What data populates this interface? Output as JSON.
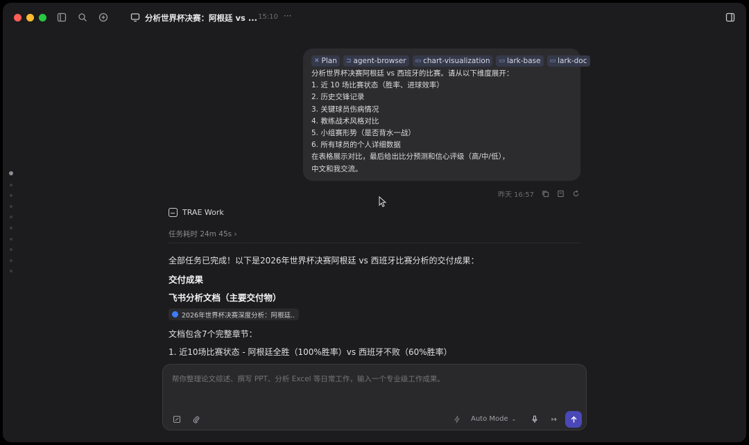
{
  "titlebar": {
    "title": "分析世界杯决赛：阿根廷 vs ...",
    "time": "15:10",
    "more": "···"
  },
  "user_message": {
    "chips": [
      {
        "icon": "plan-icon",
        "label": "Plan"
      },
      {
        "icon": "browser-icon",
        "label": "agent-browser"
      },
      {
        "icon": "book-icon",
        "label": "chart-visualization"
      },
      {
        "icon": "book-icon",
        "label": "lark-base"
      },
      {
        "icon": "book-icon",
        "label": "lark-doc"
      }
    ],
    "lines": [
      "分析世界杯决赛阿根廷 vs 西班牙的比赛。请从以下维度展开：",
      "1. 近 10 场比赛状态（胜率、进球效率）",
      "2. 历史交锋记录",
      "3. 关键球员伤病情况",
      "4. 教练战术风格对比",
      "5. 小组赛形势（是否背水一战）",
      "6. 所有球员的个人详细数据",
      "在表格展示对比，最后给出比分预测和信心评级（高/中/低），",
      "中文和我交流。"
    ],
    "timestamp": "昨天 16:57"
  },
  "assistant": {
    "name": "TRAE Work",
    "duration": "任务耗时 24m 45s ›",
    "intro": "全部任务已完成！以下是2026年世界杯决赛阿根廷 vs 西班牙比赛分析的交付成果：",
    "heading1": "交付成果",
    "heading2": "飞书分析文档（主要交付物）",
    "doc_title": "2026年世界杯决赛深度分析：阿根廷...",
    "doc_note": "文档包含7个完整章节：",
    "item1": "1. 近10场比赛状态 - 阿根廷全胜（100%胜率）vs 西班牙不败（60%胜率）"
  },
  "composer": {
    "placeholder": "帮你整理论文综述、撰写 PPT、分析 Excel 等日常工作，输入一个专业级工作成果。",
    "mode": "Auto Mode"
  },
  "colors": {
    "window_bg": "#1c1c1e",
    "bubble_bg": "#2c2c2f",
    "send_button": "#4a48b8"
  }
}
